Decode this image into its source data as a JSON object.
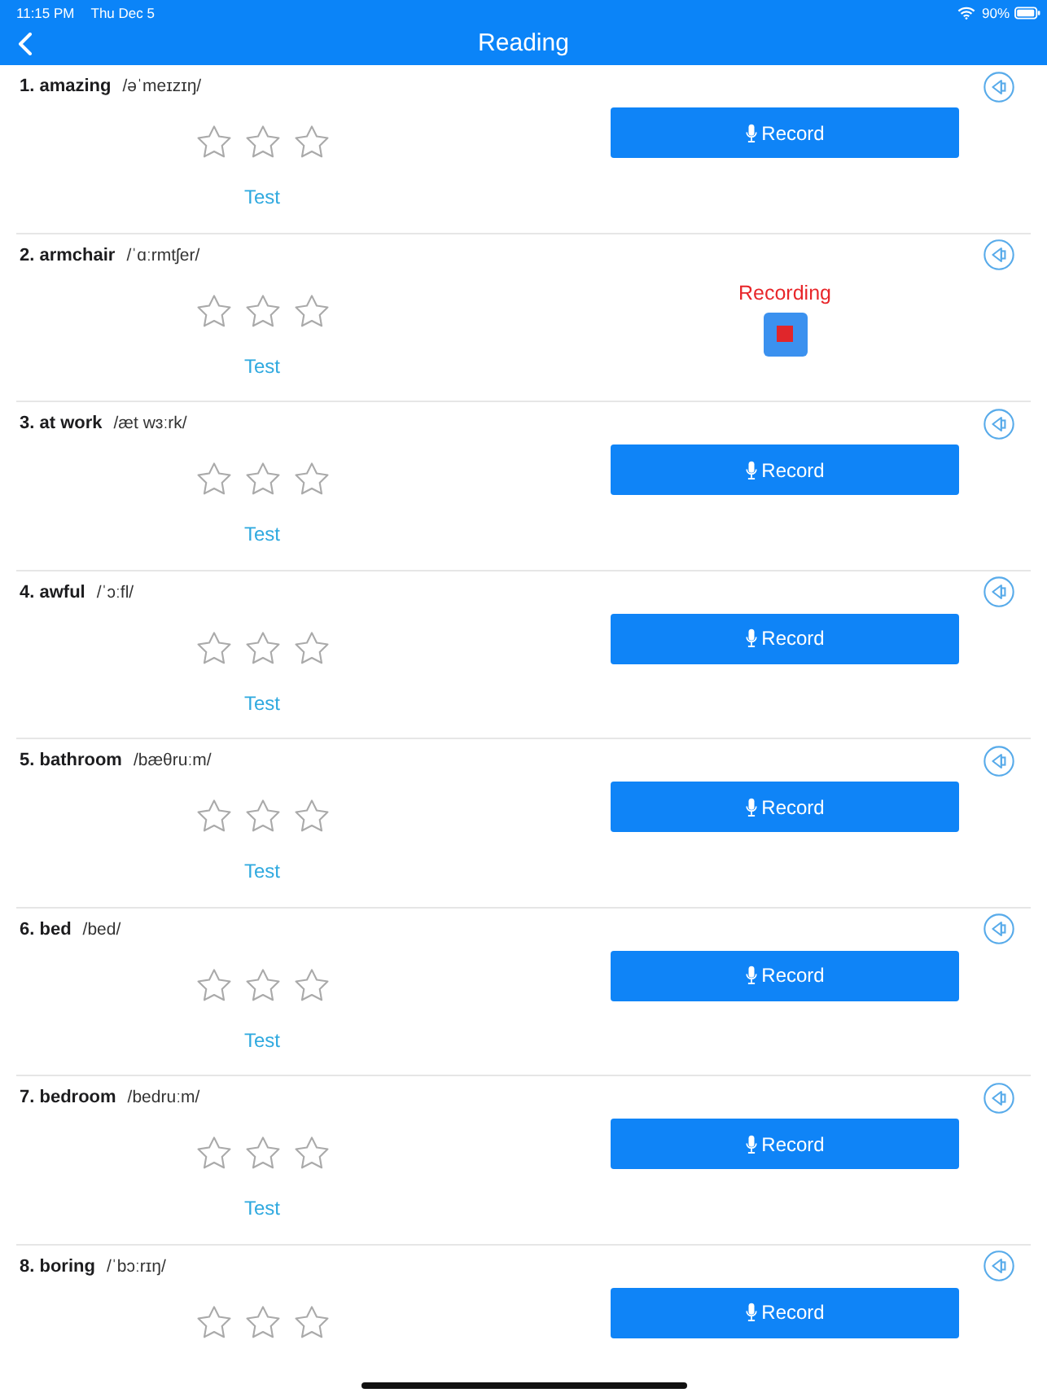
{
  "status_bar": {
    "time": "11:15 PM",
    "date": "Thu Dec 5",
    "battery": "90%"
  },
  "nav": {
    "title": "Reading"
  },
  "items": [
    {
      "title": "1. amazing",
      "phonetic": "/əˈmeɪzɪŋ/",
      "stars": 0,
      "test": "Test",
      "recording": false,
      "record_label": "Record"
    },
    {
      "title": "2. armchair",
      "phonetic": "/ˈɑːrmtʃer/",
      "stars": 0,
      "test": "Test",
      "recording": true,
      "recording_label": "Recording"
    },
    {
      "title": "3. at work",
      "phonetic": "/æt wɜːrk/",
      "stars": 0,
      "test": "Test",
      "recording": false,
      "record_label": "Record"
    },
    {
      "title": "4. awful",
      "phonetic": "/ˈɔːfl/",
      "stars": 0,
      "test": "Test",
      "recording": false,
      "record_label": "Record"
    },
    {
      "title": "5. bathroom",
      "phonetic": "/bæθruːm/",
      "stars": 0,
      "test": "Test",
      "recording": false,
      "record_label": "Record"
    },
    {
      "title": "6. bed",
      "phonetic": "/bed/",
      "stars": 0,
      "test": "Test",
      "recording": false,
      "record_label": "Record"
    },
    {
      "title": "7. bedroom",
      "phonetic": "/bedruːm/",
      "stars": 0,
      "test": "Test",
      "recording": false,
      "record_label": "Record"
    },
    {
      "title": "8. boring",
      "phonetic": "/ˈbɔːrɪŋ/",
      "stars": 0,
      "recording": false,
      "record_label": "Record"
    }
  ]
}
